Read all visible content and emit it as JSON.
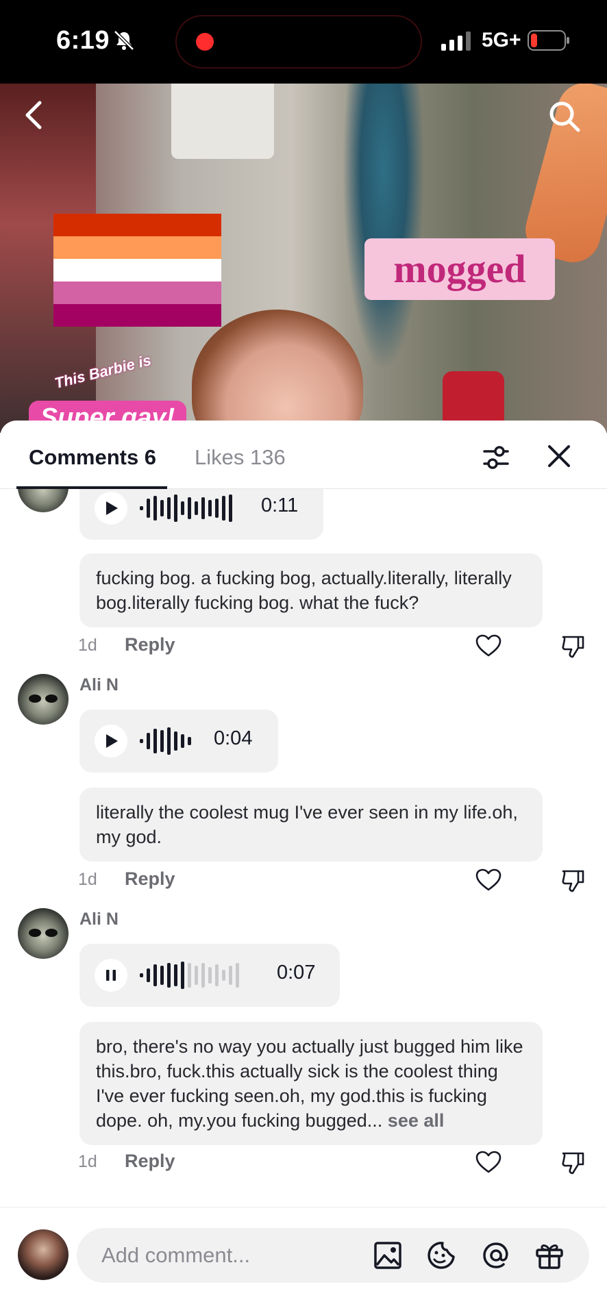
{
  "status_bar": {
    "time": "6:19",
    "network": "5G+",
    "battery_color": "#ff3b30",
    "recording_color": "#ff2d2d"
  },
  "video": {
    "sticker_text": "mogged",
    "caption_line1": "This Barbie is",
    "caption_line2": "Super gay!",
    "flag_colors": [
      "#d52d00",
      "#ff9a56",
      "#ffffff",
      "#d362a4",
      "#a30262"
    ]
  },
  "tabs": {
    "comments_label": "Comments 6",
    "likes_label": "Likes 136"
  },
  "comments": [
    {
      "voice_duration": "0:11",
      "text": "fucking bog. a fucking bog, actually.literally, literally bog.literally fucking bog. what the fuck?",
      "time": "1d",
      "reply_label": "Reply"
    },
    {
      "username": "Ali N",
      "voice_duration": "0:04",
      "text": "literally the coolest mug I've ever seen in my life.oh, my god.",
      "time": "1d",
      "reply_label": "Reply"
    },
    {
      "username": "Ali N",
      "voice_duration": "0:07",
      "voice_state": "playing",
      "text": "bro, there's no way you actually just bugged him like this.bro, fuck.this actually sick is the coolest thing I've ever fucking seen.oh, my god.this is fucking dope. oh, my.you fucking bugged...",
      "see_all": "see all",
      "time": "1d",
      "reply_label": "Reply"
    }
  ],
  "composer": {
    "placeholder": "Add comment..."
  },
  "colors": {
    "text_primary": "#161823",
    "text_secondary": "#8a8b91",
    "bubble_bg": "#f1f1f2",
    "sticker_bg": "#f6c5dc",
    "sticker_text": "#c0287a"
  }
}
